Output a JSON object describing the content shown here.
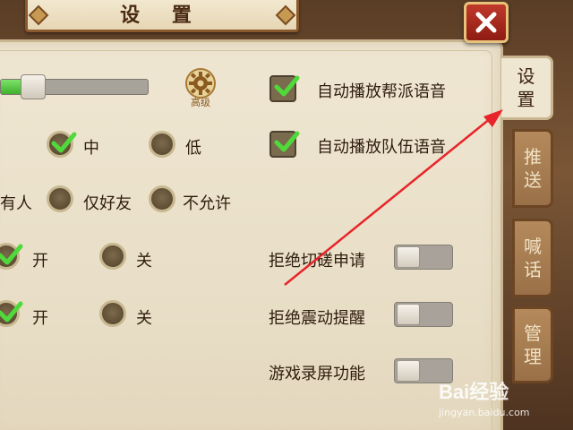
{
  "window": {
    "title": "设 置"
  },
  "tabs": [
    {
      "label": [
        "设",
        "置"
      ],
      "active": true
    },
    {
      "label": [
        "推",
        "送"
      ],
      "active": false
    },
    {
      "label": [
        "喊",
        "话"
      ],
      "active": false
    },
    {
      "label": [
        "管",
        "理"
      ],
      "active": false
    }
  ],
  "volume": {
    "level_fraction": 0.14,
    "advanced_label": "高级"
  },
  "graphics_quality": {
    "options": [
      "中",
      "低"
    ],
    "selected": "中"
  },
  "friend_permission": {
    "prefix_text": "有人",
    "options": [
      "仅好友",
      "不允许"
    ]
  },
  "row_a": {
    "on_label": "开",
    "off_label": "关",
    "selected": "开"
  },
  "row_b": {
    "on_label": "开",
    "off_label": "关",
    "selected": "开"
  },
  "auto_play": {
    "guild_voice": {
      "label": "自动播放帮派语音",
      "checked": true
    },
    "team_voice": {
      "label": "自动播放队伍语音",
      "checked": true
    }
  },
  "toggles": [
    {
      "label": "拒绝切磋申请",
      "on": false
    },
    {
      "label": "拒绝震动提醒",
      "on": false
    },
    {
      "label": "游戏录屏功能",
      "on": false
    }
  ],
  "watermark": {
    "brand": "Bai经验",
    "url": "jingyan.baidu.com"
  },
  "colors": {
    "accent_green": "#3fb02c",
    "close_red": "#c0392b",
    "annotation_red": "#e8242a"
  }
}
